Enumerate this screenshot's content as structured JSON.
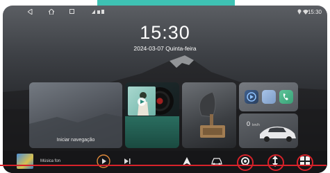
{
  "status_bar": {
    "time": "15:30",
    "icons": [
      "back-icon",
      "home-icon",
      "recents-icon",
      "signal-icon",
      "sd-icon",
      "battery-icon",
      "location-icon",
      "wifi-icon"
    ]
  },
  "clock": {
    "time": "15:30",
    "date": "2024-03-07 Quinta-feira"
  },
  "cards": {
    "navigation_label": "Iniciar navegação",
    "speed_value": "0",
    "speed_unit": "km/h"
  },
  "dock": {
    "track_title": "Música fon",
    "icons": [
      "play-icon",
      "next-icon",
      "navigation-arrow-icon",
      "car-icon",
      "rotate-icon",
      "up-down-icon",
      "apps-grid-icon"
    ]
  },
  "colors": {
    "accent_teal": "#3ec2b3",
    "highlight_red": "#d8222a"
  }
}
